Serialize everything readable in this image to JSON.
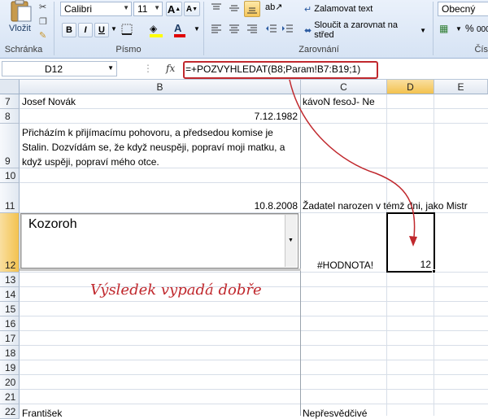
{
  "ribbon": {
    "paste_label": "Vložit",
    "clipboard_label": "Schránka",
    "font_name": "Calibri",
    "font_size": "11",
    "grow_label": "A",
    "shrink_label": "A",
    "bold_label": "B",
    "italic_label": "I",
    "underline_label": "U",
    "font_color_label": "A",
    "font_group_label": "Písmo",
    "wrap_text_label": "Zalamovat text",
    "merge_center_label": "Sloučit a zarovnat na střed",
    "alignment_group_label": "Zarovnání",
    "number_format": "Obecný",
    "percent_label": "%",
    "comma_label": "000",
    "number_group_label": "Číslo"
  },
  "formula_bar": {
    "name_box": "D12",
    "fx_label": "fx",
    "formula": "=+POZVYHLEDAT(B8;Param!B7:B19;1)"
  },
  "columns": [
    "B",
    "C",
    "D",
    "E"
  ],
  "rows": [
    "7",
    "8",
    "9",
    "10",
    "11",
    "12",
    "13",
    "14",
    "15",
    "16",
    "17",
    "18",
    "19",
    "20",
    "21",
    "22"
  ],
  "cells": {
    "b7": "Josef Novák",
    "c7": "kávoN fesoJ- Ne",
    "b8": "7.12.1982",
    "b9_line1": "Přicházím k přijímacímu pohovoru, a předsedou komise je",
    "b9_line2": "Stalin. Dozvídám se, že když neuspěji, popraví moji matku, a",
    "b9_line3": "když uspěji, popraví mého otce.",
    "b11": "10.8.2008",
    "c11": "Žadatel narozen v témž dni, jako Mistr",
    "b12_dropdown_value": "Kozoroh",
    "c12": "#HODNOTA!",
    "d12": "12",
    "b22": "František",
    "c22": "Nepřesvědčivé"
  },
  "annotation": {
    "handwritten_note": "Výsledek vypadá dobře",
    "color": "#c0282d"
  },
  "colors": {
    "ribbon_bg": "#dbe6f4",
    "selected_header": "#f5c95a",
    "highlight": "#c0282d"
  }
}
